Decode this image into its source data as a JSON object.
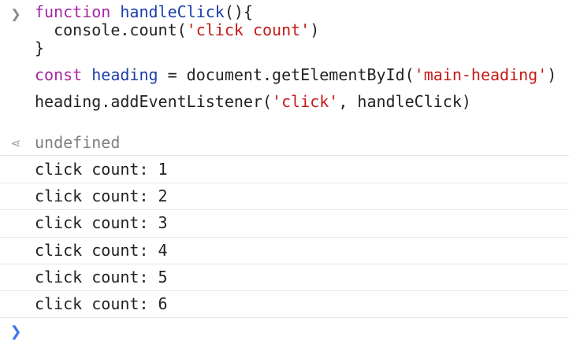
{
  "input": {
    "lines": [
      [
        [
          "kw",
          "function"
        ],
        [
          "plain",
          " "
        ],
        [
          "fn",
          "handleClick"
        ],
        [
          "plain",
          "(){"
        ]
      ],
      [
        [
          "plain",
          "  console.count("
        ],
        [
          "str",
          "'click count'"
        ],
        [
          "plain",
          ")"
        ]
      ],
      [
        [
          "plain",
          "}"
        ]
      ],
      [],
      [
        [
          "kw",
          "const"
        ],
        [
          "plain",
          " "
        ],
        [
          "fn",
          "heading"
        ],
        [
          "plain",
          " = document.getElementById("
        ],
        [
          "str",
          "'main-heading'"
        ],
        [
          "plain",
          ")"
        ]
      ],
      [],
      [
        [
          "plain",
          "heading.addEventListener("
        ],
        [
          "str",
          "'click'"
        ],
        [
          "plain",
          ", handleClick)"
        ]
      ]
    ]
  },
  "prompts": {
    "input_glyph": "❯",
    "return_glyph": "⋖",
    "active_glyph": "❯"
  },
  "return_value": "undefined",
  "logs": [
    "click count: 1",
    "click count: 2",
    "click count: 3",
    "click count: 4",
    "click count: 5",
    "click count: 6"
  ],
  "colors": {
    "keyword": "#a626a4",
    "identifier": "#1c3fa8",
    "string": "#c41a16",
    "prompt_active": "#3b78e7"
  }
}
